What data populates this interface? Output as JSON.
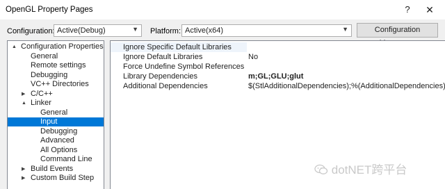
{
  "window": {
    "title": "OpenGL Property Pages",
    "help_glyph": "?",
    "close_glyph": "✕"
  },
  "toolbar": {
    "configuration_label": "Configuration:",
    "configuration_value": "Active(Debug)",
    "platform_label": "Platform:",
    "platform_value": "Active(x64)",
    "manager_button": "Configuration Manager..."
  },
  "tree": {
    "items": [
      {
        "label": "Configuration Properties",
        "expander": "▲"
      },
      {
        "label": "General",
        "expander": ""
      },
      {
        "label": "Remote settings",
        "expander": ""
      },
      {
        "label": "Debugging",
        "expander": ""
      },
      {
        "label": "VC++ Directories",
        "expander": ""
      },
      {
        "label": "C/C++",
        "expander": "▶"
      },
      {
        "label": "Linker",
        "expander": "▲"
      },
      {
        "label": "General",
        "expander": ""
      },
      {
        "label": "Input",
        "expander": ""
      },
      {
        "label": "Debugging",
        "expander": ""
      },
      {
        "label": "Advanced",
        "expander": ""
      },
      {
        "label": "All Options",
        "expander": ""
      },
      {
        "label": "Command Line",
        "expander": ""
      },
      {
        "label": "Build Events",
        "expander": "▶"
      },
      {
        "label": "Custom Build Step",
        "expander": "▶"
      }
    ]
  },
  "grid": {
    "rows": [
      {
        "name": "Ignore Specific Default Libraries",
        "value": ""
      },
      {
        "name": "Ignore Default Libraries",
        "value": "No"
      },
      {
        "name": "Force Undefine Symbol References",
        "value": ""
      },
      {
        "name": "Library Dependencies",
        "value": "m;GL;GLU;glut"
      },
      {
        "name": "Additional Dependencies",
        "value": "$(StlAdditionalDependencies);%(AdditionalDependencies)"
      }
    ]
  },
  "watermark": {
    "text": "dotNET跨平台"
  },
  "colors": {
    "selection": "#0078d7",
    "panel": "#f0f0f0",
    "border": "#828790"
  }
}
